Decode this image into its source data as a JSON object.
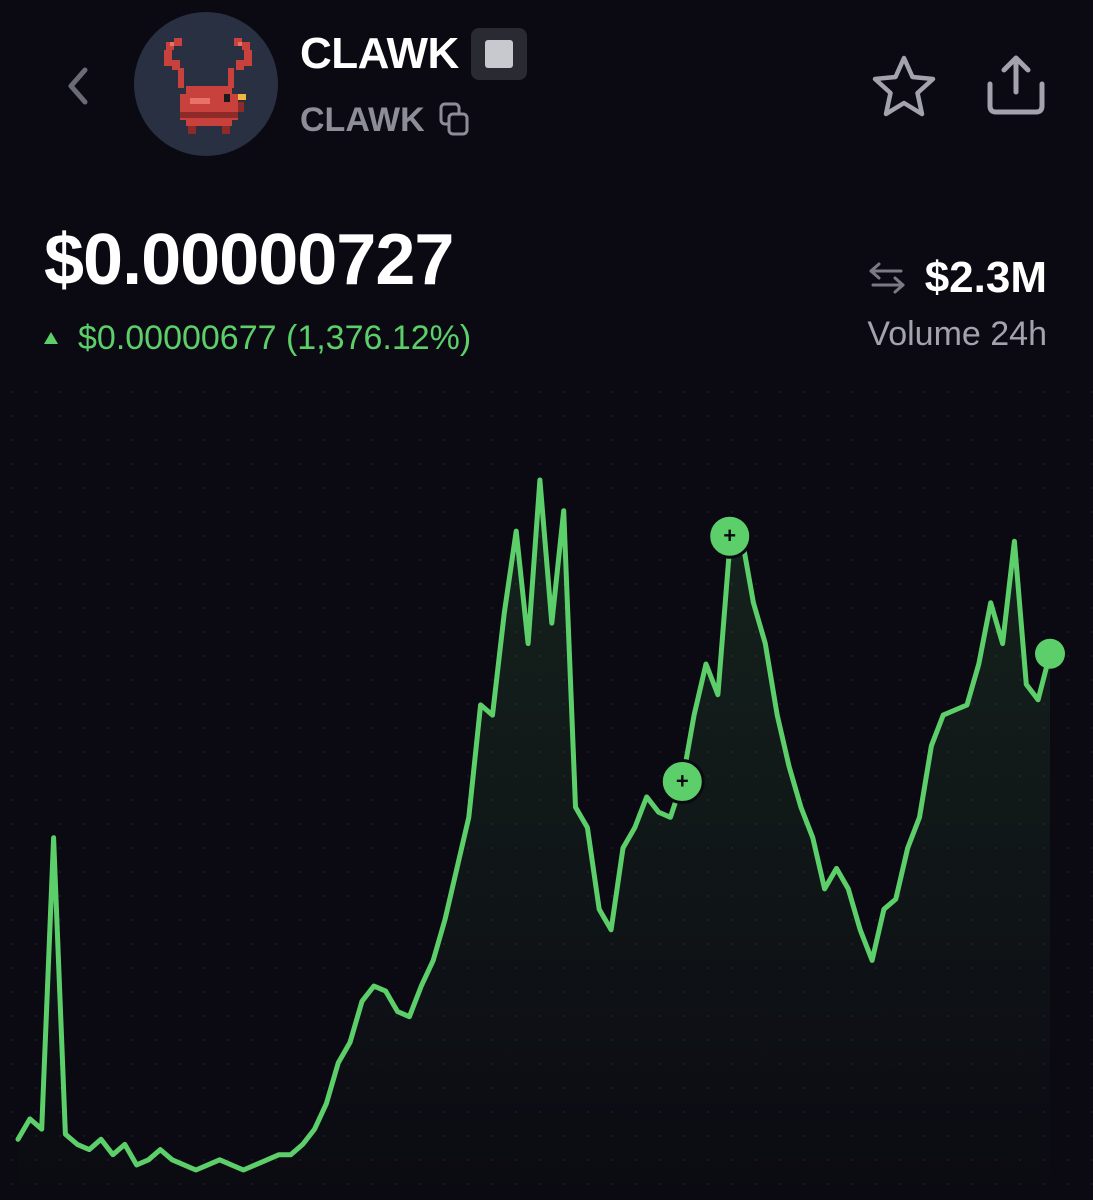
{
  "token": {
    "name": "CLAWK",
    "symbol": "CLAWK",
    "avatar_icon": "crab-icon",
    "chain_icon": "chain-square-icon"
  },
  "header": {
    "back_icon": "chevron-left-icon",
    "favorite_icon": "star-icon",
    "share_icon": "share-icon",
    "copy_icon": "copy-icon"
  },
  "price": {
    "current": "$0.00000727",
    "change": "$0.00000677 (1,376.12%)",
    "direction": "up"
  },
  "volume": {
    "value": "$2.3M",
    "label": "Volume 24h",
    "icon": "swap-arrows-icon"
  },
  "colors": {
    "background": "#0b0a12",
    "positive": "#5ccf6a",
    "muted": "#8d8d98"
  },
  "chart_data": {
    "type": "line",
    "series": [
      {
        "values": [
          0.35,
          0.55,
          0.45,
          3.3,
          0.4,
          0.3,
          0.25,
          0.35,
          0.2,
          0.3,
          0.1,
          0.15,
          0.25,
          0.15,
          0.1,
          0.05,
          0.1,
          0.15,
          0.1,
          0.05,
          0.1,
          0.15,
          0.2,
          0.2,
          0.3,
          0.45,
          0.7,
          1.1,
          1.3,
          1.7,
          1.85,
          1.8,
          1.6,
          1.55,
          1.85,
          2.1,
          2.5,
          3.0,
          3.5,
          4.6,
          4.5,
          5.5,
          6.3,
          5.2,
          6.8,
          5.4,
          6.5,
          3.6,
          3.4,
          2.6,
          2.4,
          3.2,
          3.4,
          3.7,
          3.55,
          3.5,
          3.85,
          4.5,
          5.0,
          4.7,
          6.15,
          6.25,
          5.6,
          5.2,
          4.5,
          4.0,
          3.6,
          3.3,
          2.8,
          3.0,
          2.8,
          2.4,
          2.1,
          2.6,
          2.7,
          3.2,
          3.5,
          4.2,
          4.5,
          4.55,
          4.6,
          5.0,
          5.6,
          5.2,
          6.2,
          4.8,
          4.65,
          5.1
        ]
      }
    ],
    "markers": [
      {
        "index": 56,
        "value": 3.85,
        "label": "+"
      },
      {
        "index": 60,
        "value": 6.25,
        "label": "+"
      }
    ],
    "grid": true,
    "legend": "none"
  }
}
